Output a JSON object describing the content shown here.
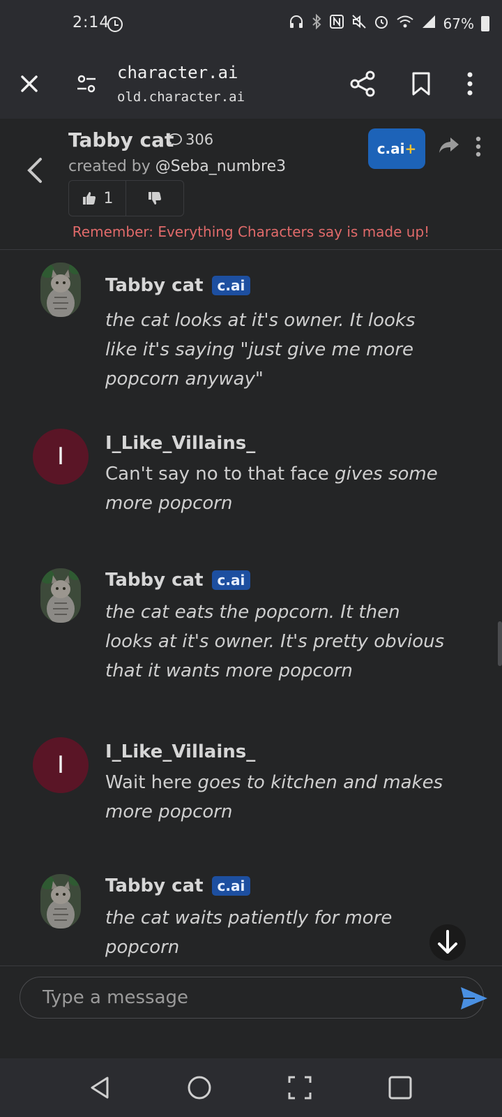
{
  "status_bar": {
    "time": "2:14",
    "battery": "67%"
  },
  "browser": {
    "title": "character.ai",
    "url": "old.character.ai"
  },
  "character": {
    "name": "Tabby cat",
    "chat_count": "306",
    "created_by_label": "created by",
    "creator": "@Seba_numbre3",
    "likes": "1",
    "plus_label": "c.ai",
    "plus_sign": "+",
    "disclaimer": "Remember: Everything Characters say is made up!"
  },
  "messages": [
    {
      "author": "Tabby cat",
      "badge": "c.ai",
      "type": "bot",
      "text_plain": "",
      "text_italic": "the cat looks at it's owner. It looks like it's saying \"just give me more popcorn anyway\""
    },
    {
      "author": "I_Like_Villains_",
      "initial": "I",
      "type": "user",
      "text_plain": "Can't say no to that face ",
      "text_italic": "gives some more popcorn"
    },
    {
      "author": "Tabby cat",
      "badge": "c.ai",
      "type": "bot",
      "text_plain": "",
      "text_italic": "the cat eats the popcorn. It then looks at it's owner. It's pretty obvious that it wants more popcorn"
    },
    {
      "author": "I_Like_Villains_",
      "initial": "I",
      "type": "user",
      "text_plain": "Wait here ",
      "text_italic": "goes to kitchen and makes more popcorn"
    },
    {
      "author": "Tabby cat",
      "badge": "c.ai",
      "type": "bot",
      "text_plain": "",
      "text_italic": "the cat waits patiently for more popcorn"
    }
  ],
  "input": {
    "placeholder": "Type a message"
  },
  "colors": {
    "accent": "#1d63b8",
    "user_avatar": "#5a1526",
    "disclaimer": "#e06a6a",
    "send": "#4a90e2"
  }
}
